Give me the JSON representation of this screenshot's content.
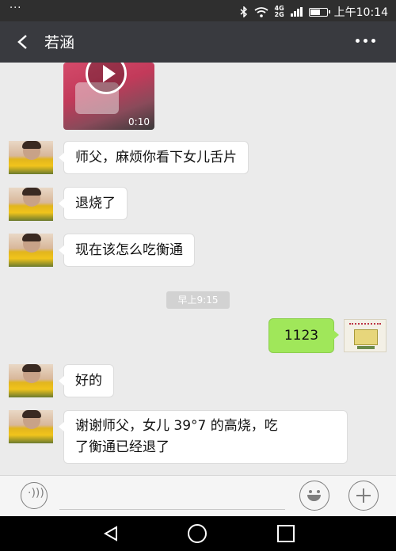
{
  "status_bar": {
    "left_dots": "···",
    "network_top": "4G",
    "network_bottom": "2G",
    "time": "上午10:14"
  },
  "title_bar": {
    "contact_name": "若涵",
    "back_icon": "chevron-left-icon",
    "more_icon": "more-dots-icon"
  },
  "video_message": {
    "duration": "0:10"
  },
  "messages_before": [
    {
      "text": "师父，麻烦你看下女儿舌片"
    },
    {
      "text": "退烧了"
    },
    {
      "text": "现在该怎么吃衡通"
    }
  ],
  "timestamp": "早上9:15",
  "my_message": {
    "text": "1123"
  },
  "messages_after": [
    {
      "text": "好的"
    },
    {
      "line1": "谢谢师父，女儿 39°7 的高烧，吃",
      "line2": "了衡通已经退了"
    }
  ],
  "colors": {
    "title_bar_bg": "#393a3f",
    "chat_bg": "#ebebeb",
    "my_bubble": "#a0e75a",
    "other_bubble": "#ffffff"
  },
  "icons": {
    "voice": "voice-icon",
    "emoji": "emoji-icon",
    "plus": "plus-icon",
    "nav_back": "nav-back-icon",
    "nav_home": "nav-home-icon",
    "nav_recent": "nav-recent-icon"
  }
}
